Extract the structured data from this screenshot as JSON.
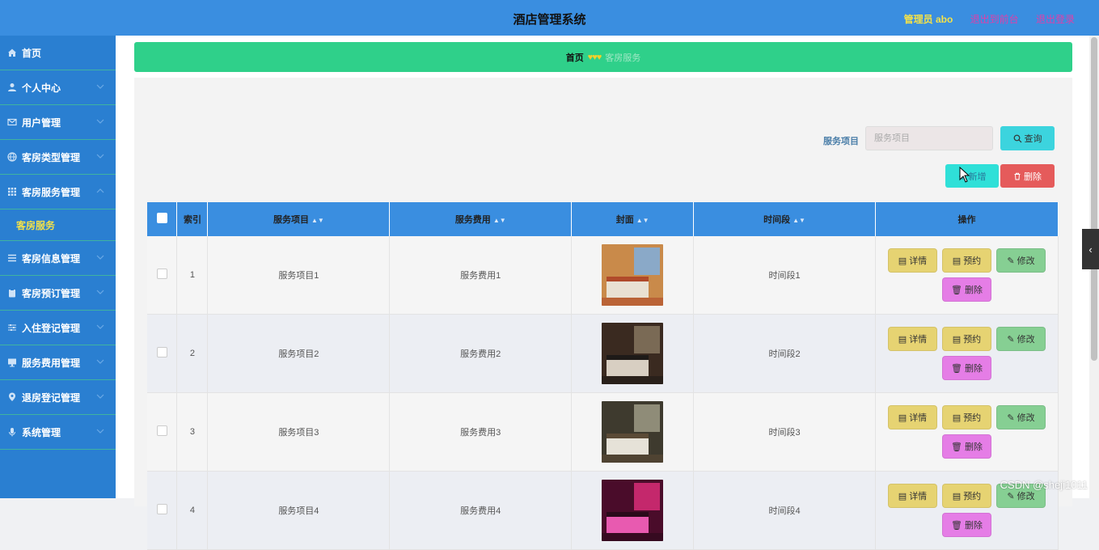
{
  "header": {
    "title": "酒店管理系统",
    "admin": "管理员 abo",
    "back_to_front": "退出到前台",
    "logout": "退出登录"
  },
  "sidebar": {
    "items": [
      {
        "label": "首页",
        "icon": "home-icon"
      },
      {
        "label": "个人中心",
        "icon": "user-icon"
      },
      {
        "label": "用户管理",
        "icon": "mail-icon"
      },
      {
        "label": "客房类型管理",
        "icon": "globe-icon"
      },
      {
        "label": "客房服务管理",
        "icon": "grid-icon",
        "expanded": true,
        "children": [
          {
            "label": "客房服务"
          }
        ]
      },
      {
        "label": "客房信息管理",
        "icon": "list-icon"
      },
      {
        "label": "客房预订管理",
        "icon": "clipboard-icon"
      },
      {
        "label": "入住登记管理",
        "icon": "sliders-icon"
      },
      {
        "label": "服务费用管理",
        "icon": "monitor-icon"
      },
      {
        "label": "退房登记管理",
        "icon": "location-icon"
      },
      {
        "label": "系统管理",
        "icon": "mic-icon"
      }
    ]
  },
  "breadcrumb": {
    "home": "首页",
    "separator": "♥♥♥",
    "current": "客房服务"
  },
  "search": {
    "label": "服务项目",
    "placeholder": "服务项目",
    "query_button": "查询"
  },
  "toolbar": {
    "add_button": "新增",
    "delete_button": "删除"
  },
  "table": {
    "columns": [
      "索引",
      "服务项目",
      "服务费用",
      "封面",
      "时间段",
      "操作"
    ],
    "rows": [
      {
        "index": "1",
        "item": "服务项目1",
        "fee": "服务费用1",
        "period": "时间段1",
        "cover": "hotel-room-photo"
      },
      {
        "index": "2",
        "item": "服务项目2",
        "fee": "服务费用2",
        "period": "时间段2",
        "cover": "hotel-room-photo"
      },
      {
        "index": "3",
        "item": "服务项目3",
        "fee": "服务费用3",
        "period": "时间段3",
        "cover": "hotel-room-photo"
      },
      {
        "index": "4",
        "item": "服务项目4",
        "fee": "服务费用4",
        "period": "时间段4",
        "cover": "hotel-room-photo"
      }
    ],
    "row_actions": {
      "detail": "详情",
      "book": "预约",
      "edit": "修改",
      "delete": "删除"
    }
  },
  "watermark": "CSDN @sheji1011",
  "colors": {
    "header": "#3a8ee0",
    "sidebar": "#2a7fd1",
    "breadcrumb": "#2fd08a",
    "active_menu": "#f3e14a",
    "delete": "#e55b5b"
  }
}
